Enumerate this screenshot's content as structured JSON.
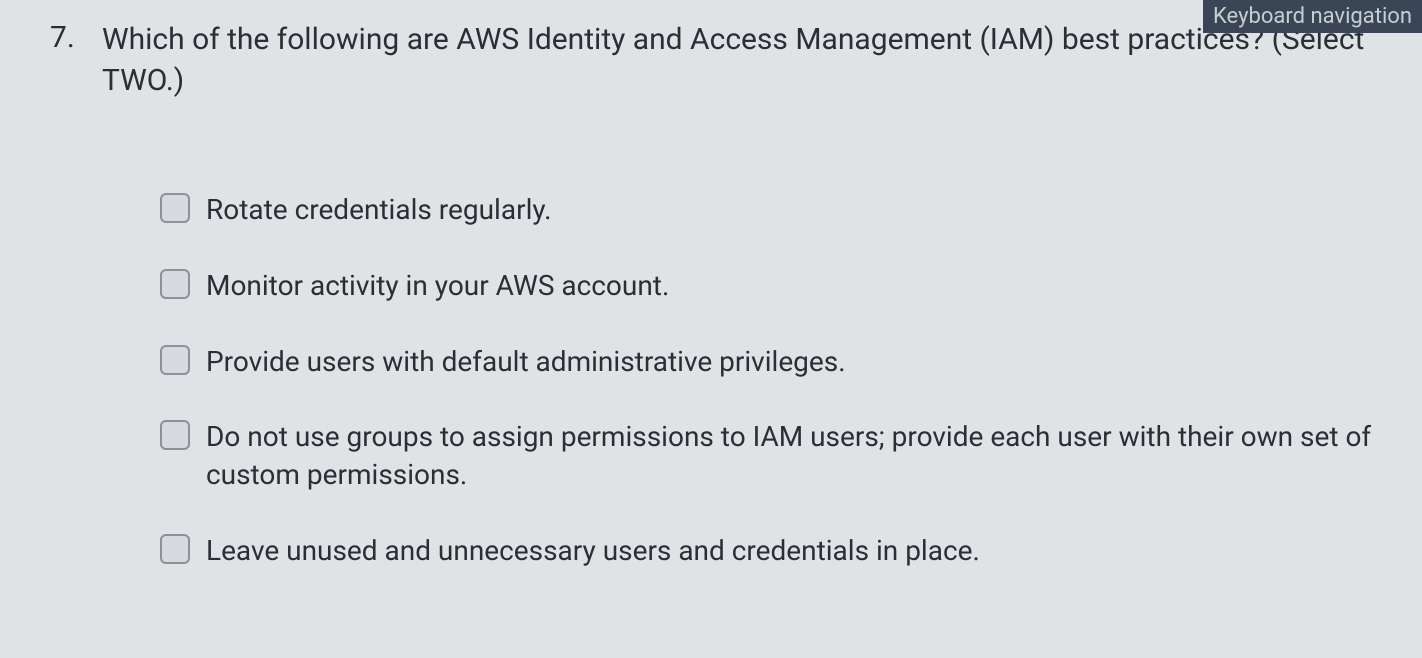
{
  "header": {
    "keyboard_nav_label": "Keyboard navigation"
  },
  "question": {
    "number": "7.",
    "text": "Which of the following are AWS Identity and Access Management (IAM) best practices? (Select TWO.)"
  },
  "options": [
    {
      "label": "Rotate credentials regularly."
    },
    {
      "label": "Monitor activity in your AWS account."
    },
    {
      "label": "Provide users with default administrative privileges."
    },
    {
      "label": "Do not use groups to assign permissions to IAM users; provide each user with their own set of custom permissions."
    },
    {
      "label": "Leave unused and unnecessary users and credentials in place."
    }
  ]
}
